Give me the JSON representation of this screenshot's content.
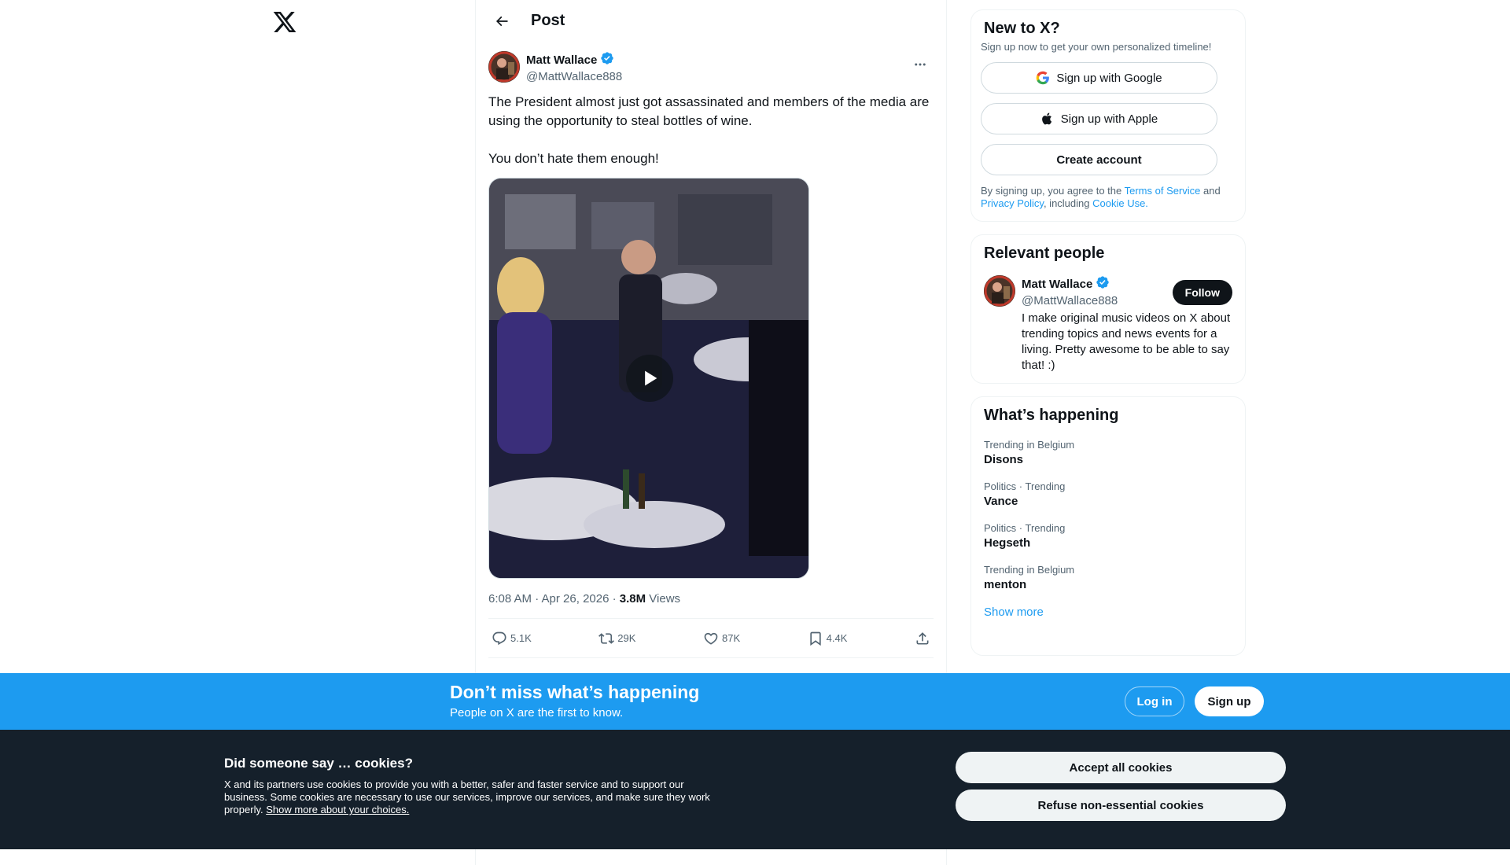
{
  "header": {
    "title": "Post"
  },
  "post": {
    "author": {
      "name": "Matt Wallace",
      "handle": "@MattWallace888",
      "verified": true
    },
    "text": "The President almost just got assassinated and members of the media are using the opportunity to steal bottles of wine.\n\nYou don’t hate them enough!",
    "time": "6:08 AM · Apr 26, 2026 · ",
    "views_count": "3.8M",
    "views_label": " Views",
    "actions": {
      "replies": "5.1K",
      "reposts": "29K",
      "likes": "87K",
      "bookmarks": "4.4K"
    }
  },
  "signup_card": {
    "title": "New to X?",
    "subtitle": "Sign up now to get your own personalized timeline!",
    "google": "Sign up with Google",
    "apple": "Sign up with Apple",
    "create": "Create account",
    "legal_1": "By signing up, you agree to the ",
    "terms": "Terms of Service",
    "legal_2": " and ",
    "privacy": "Privacy Policy",
    "legal_3": ", including ",
    "cookie_use": "Cookie Use."
  },
  "relevant_people": {
    "title": "Relevant people",
    "person": {
      "name": "Matt Wallace",
      "handle": "@MattWallace888",
      "follow": "Follow",
      "bio": "I make original music videos on X about trending topics and news events for a living. Pretty awesome to be able to say that! :)"
    }
  },
  "trends": {
    "title": "What’s happening",
    "items": [
      {
        "context": "Trending in Belgium",
        "topic": "Disons"
      },
      {
        "context": "Politics · Trending",
        "topic": "Vance"
      },
      {
        "context": "Politics · Trending",
        "topic": "Hegseth"
      },
      {
        "context": "Trending in Belgium",
        "topic": "menton"
      }
    ],
    "show_more": "Show more"
  },
  "banner": {
    "title": "Don’t miss what’s happening",
    "subtitle": "People on X are the first to know.",
    "login": "Log in",
    "signup": "Sign up"
  },
  "cookies": {
    "title": "Did someone say … cookies?",
    "text": "X and its partners use cookies to provide you with a better, safer and faster service and to support our business. Some cookies are necessary to use our services, improve our services, and make sure they work properly. ",
    "link": "Show more about your choices.",
    "accept": "Accept all cookies",
    "refuse": "Refuse non-essential cookies"
  },
  "colors": {
    "accent": "#1d9bf0",
    "text": "#0f1419",
    "muted": "#536471",
    "cookie_bg": "#15202b"
  }
}
